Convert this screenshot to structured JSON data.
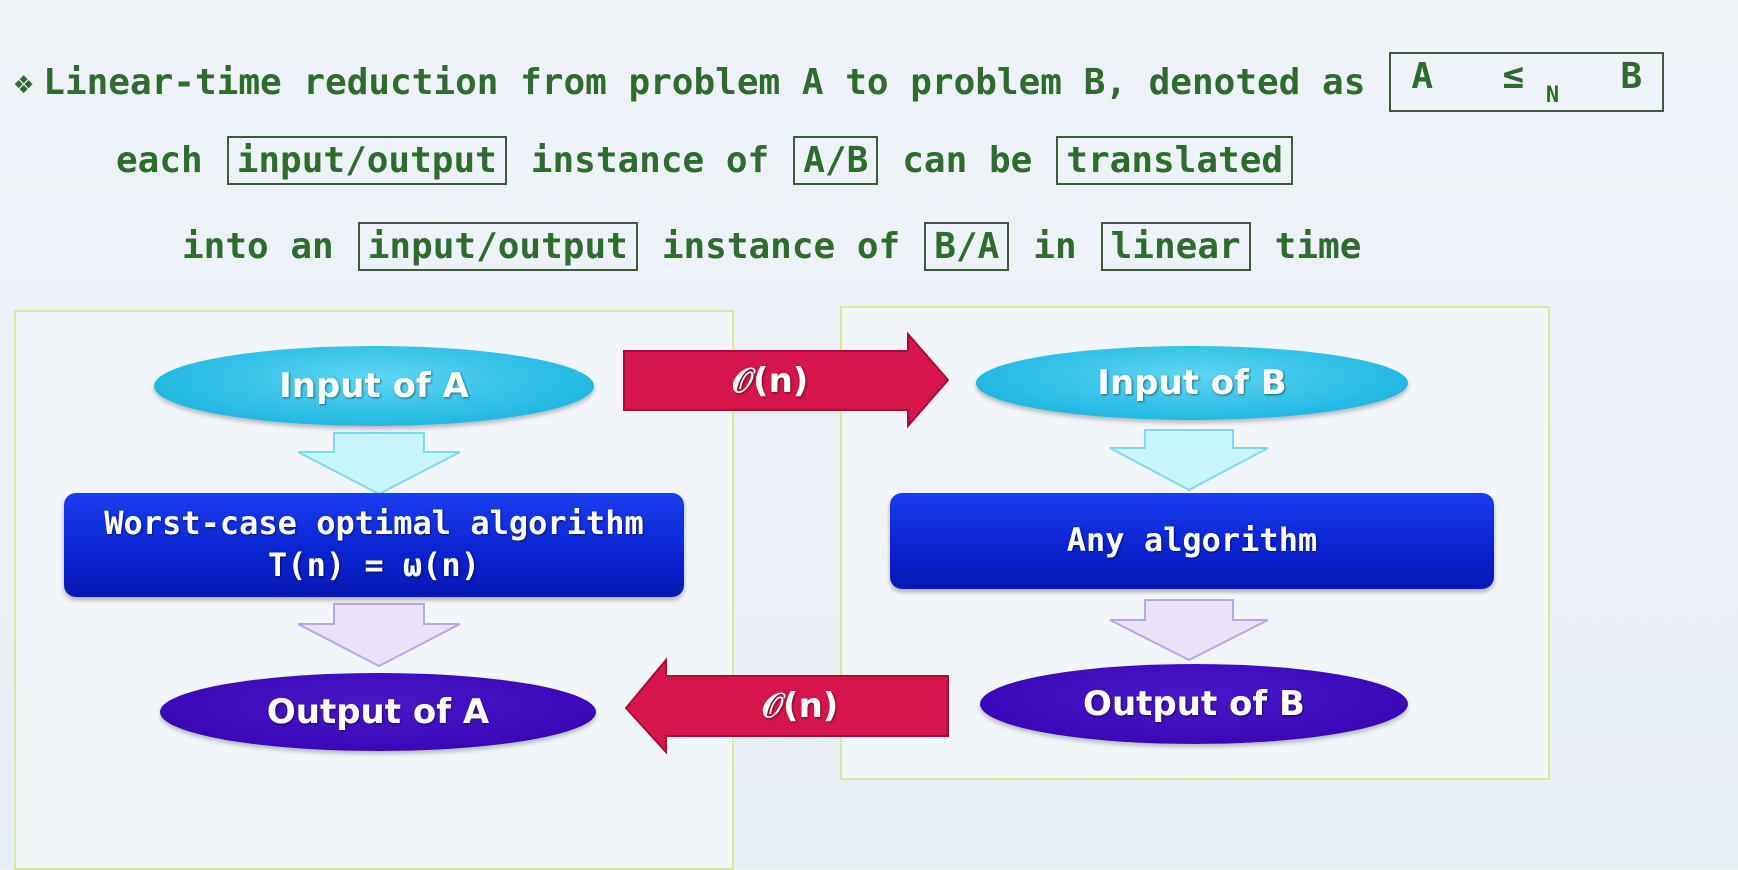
{
  "bullet_symbol": "❖",
  "header": {
    "line1": {
      "text": "Linear-time reduction from problem A to problem B, denoted as",
      "notation": {
        "left": "A",
        "symbol": "≤",
        "subscript": "N",
        "right": "B"
      }
    },
    "line2": {
      "w1": "each",
      "box1": "input/output",
      "w2": "instance of",
      "box2": "A/B",
      "w3": "can be",
      "box3": "translated"
    },
    "line3": {
      "w1": "into an",
      "box1": "input/output",
      "w2": "instance of",
      "box2": "B/A",
      "w3": "in",
      "box3": "linear",
      "w4": "time"
    }
  },
  "left_panel": {
    "input": "Input of A",
    "algorithm_line1": "Worst-case optimal algorithm",
    "algorithm_line2": "T(n) = ω(n)",
    "output": "Output of A"
  },
  "right_panel": {
    "input": "Input of B",
    "algorithm": "Any algorithm",
    "output": "Output of B"
  },
  "arrows": {
    "forward_label": "𝒪(n)",
    "backward_label": "𝒪(n)"
  },
  "colors": {
    "text_green": "#2f6b2f",
    "ellipse_input": "#22b9e3",
    "ellipse_output": "#3a08b8",
    "algorithm_box": "#0a22d0",
    "red_arrow": "#d6154a",
    "down_arrow_cyan": "#bff3fb",
    "down_arrow_lavender": "#e2d6f7"
  }
}
